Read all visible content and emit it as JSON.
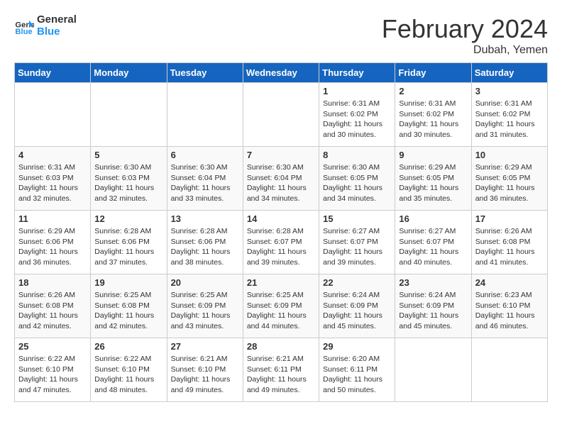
{
  "header": {
    "logo_general": "General",
    "logo_blue": "Blue",
    "month_title": "February 2024",
    "location": "Dubah, Yemen"
  },
  "days_of_week": [
    "Sunday",
    "Monday",
    "Tuesday",
    "Wednesday",
    "Thursday",
    "Friday",
    "Saturday"
  ],
  "weeks": [
    [
      {
        "day": "",
        "info": ""
      },
      {
        "day": "",
        "info": ""
      },
      {
        "day": "",
        "info": ""
      },
      {
        "day": "",
        "info": ""
      },
      {
        "day": "1",
        "info": "Sunrise: 6:31 AM\nSunset: 6:02 PM\nDaylight: 11 hours\nand 30 minutes."
      },
      {
        "day": "2",
        "info": "Sunrise: 6:31 AM\nSunset: 6:02 PM\nDaylight: 11 hours\nand 30 minutes."
      },
      {
        "day": "3",
        "info": "Sunrise: 6:31 AM\nSunset: 6:02 PM\nDaylight: 11 hours\nand 31 minutes."
      }
    ],
    [
      {
        "day": "4",
        "info": "Sunrise: 6:31 AM\nSunset: 6:03 PM\nDaylight: 11 hours\nand 32 minutes."
      },
      {
        "day": "5",
        "info": "Sunrise: 6:30 AM\nSunset: 6:03 PM\nDaylight: 11 hours\nand 32 minutes."
      },
      {
        "day": "6",
        "info": "Sunrise: 6:30 AM\nSunset: 6:04 PM\nDaylight: 11 hours\nand 33 minutes."
      },
      {
        "day": "7",
        "info": "Sunrise: 6:30 AM\nSunset: 6:04 PM\nDaylight: 11 hours\nand 34 minutes."
      },
      {
        "day": "8",
        "info": "Sunrise: 6:30 AM\nSunset: 6:05 PM\nDaylight: 11 hours\nand 34 minutes."
      },
      {
        "day": "9",
        "info": "Sunrise: 6:29 AM\nSunset: 6:05 PM\nDaylight: 11 hours\nand 35 minutes."
      },
      {
        "day": "10",
        "info": "Sunrise: 6:29 AM\nSunset: 6:05 PM\nDaylight: 11 hours\nand 36 minutes."
      }
    ],
    [
      {
        "day": "11",
        "info": "Sunrise: 6:29 AM\nSunset: 6:06 PM\nDaylight: 11 hours\nand 36 minutes."
      },
      {
        "day": "12",
        "info": "Sunrise: 6:28 AM\nSunset: 6:06 PM\nDaylight: 11 hours\nand 37 minutes."
      },
      {
        "day": "13",
        "info": "Sunrise: 6:28 AM\nSunset: 6:06 PM\nDaylight: 11 hours\nand 38 minutes."
      },
      {
        "day": "14",
        "info": "Sunrise: 6:28 AM\nSunset: 6:07 PM\nDaylight: 11 hours\nand 39 minutes."
      },
      {
        "day": "15",
        "info": "Sunrise: 6:27 AM\nSunset: 6:07 PM\nDaylight: 11 hours\nand 39 minutes."
      },
      {
        "day": "16",
        "info": "Sunrise: 6:27 AM\nSunset: 6:07 PM\nDaylight: 11 hours\nand 40 minutes."
      },
      {
        "day": "17",
        "info": "Sunrise: 6:26 AM\nSunset: 6:08 PM\nDaylight: 11 hours\nand 41 minutes."
      }
    ],
    [
      {
        "day": "18",
        "info": "Sunrise: 6:26 AM\nSunset: 6:08 PM\nDaylight: 11 hours\nand 42 minutes."
      },
      {
        "day": "19",
        "info": "Sunrise: 6:25 AM\nSunset: 6:08 PM\nDaylight: 11 hours\nand 42 minutes."
      },
      {
        "day": "20",
        "info": "Sunrise: 6:25 AM\nSunset: 6:09 PM\nDaylight: 11 hours\nand 43 minutes."
      },
      {
        "day": "21",
        "info": "Sunrise: 6:25 AM\nSunset: 6:09 PM\nDaylight: 11 hours\nand 44 minutes."
      },
      {
        "day": "22",
        "info": "Sunrise: 6:24 AM\nSunset: 6:09 PM\nDaylight: 11 hours\nand 45 minutes."
      },
      {
        "day": "23",
        "info": "Sunrise: 6:24 AM\nSunset: 6:09 PM\nDaylight: 11 hours\nand 45 minutes."
      },
      {
        "day": "24",
        "info": "Sunrise: 6:23 AM\nSunset: 6:10 PM\nDaylight: 11 hours\nand 46 minutes."
      }
    ],
    [
      {
        "day": "25",
        "info": "Sunrise: 6:22 AM\nSunset: 6:10 PM\nDaylight: 11 hours\nand 47 minutes."
      },
      {
        "day": "26",
        "info": "Sunrise: 6:22 AM\nSunset: 6:10 PM\nDaylight: 11 hours\nand 48 minutes."
      },
      {
        "day": "27",
        "info": "Sunrise: 6:21 AM\nSunset: 6:10 PM\nDaylight: 11 hours\nand 49 minutes."
      },
      {
        "day": "28",
        "info": "Sunrise: 6:21 AM\nSunset: 6:11 PM\nDaylight: 11 hours\nand 49 minutes."
      },
      {
        "day": "29",
        "info": "Sunrise: 6:20 AM\nSunset: 6:11 PM\nDaylight: 11 hours\nand 50 minutes."
      },
      {
        "day": "",
        "info": ""
      },
      {
        "day": "",
        "info": ""
      }
    ]
  ]
}
